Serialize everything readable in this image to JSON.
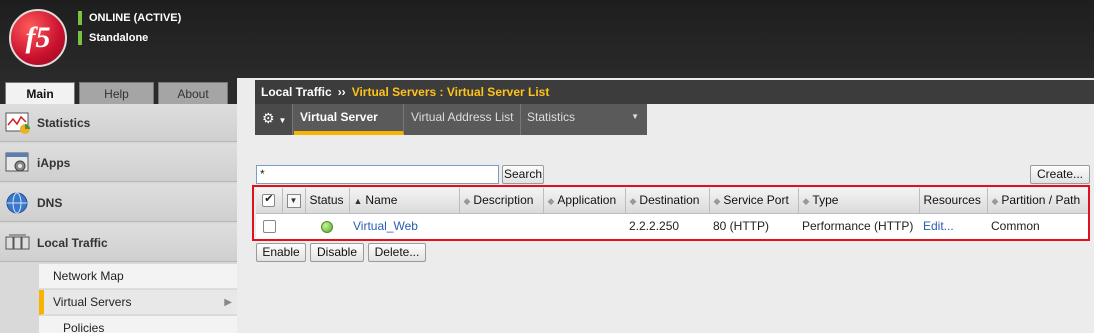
{
  "header": {
    "logo_text": "f5",
    "status_lines": [
      "ONLINE (ACTIVE)",
      "Standalone"
    ],
    "status_color": "#7bc142"
  },
  "leftnav": {
    "tabs": [
      {
        "label": "Main",
        "active": true
      },
      {
        "label": "Help",
        "active": false
      },
      {
        "label": "About",
        "active": false
      }
    ],
    "sections": [
      {
        "label": "Statistics",
        "icon": "statistics-chart-icon"
      },
      {
        "label": "iApps",
        "icon": "iapps-gear-icon"
      },
      {
        "label": "DNS",
        "icon": "dns-globe-icon"
      },
      {
        "label": "Local Traffic",
        "icon": "local-traffic-icon"
      }
    ],
    "subitems": [
      {
        "label": "Network Map",
        "active": false
      },
      {
        "label": "Virtual Servers",
        "active": true
      },
      {
        "label": "Policies",
        "active": false
      }
    ]
  },
  "breadcrumb": {
    "root": "Local Traffic",
    "separator": "››",
    "current": "Virtual Servers : Virtual Server List"
  },
  "subtabs": [
    {
      "label": "Virtual Server List",
      "active": true
    },
    {
      "label": "Virtual Address List",
      "active": false
    },
    {
      "label": "Statistics",
      "active": false
    }
  ],
  "search": {
    "value": "*",
    "button": "Search"
  },
  "create_button": "Create...",
  "table": {
    "columns": [
      "Status",
      "Name",
      "Description",
      "Application",
      "Destination",
      "Service Port",
      "Type",
      "Resources",
      "Partition / Path"
    ],
    "rows": [
      {
        "name": "Virtual_Web",
        "description": "",
        "application": "",
        "destination": "2.2.2.250",
        "service_port": "80 (HTTP)",
        "type": "Performance (HTTP)",
        "resources": "Edit...",
        "partition": "Common"
      }
    ]
  },
  "actions": [
    "Enable",
    "Disable",
    "Delete..."
  ],
  "colors": {
    "accent": "#f6b300",
    "link": "#2a5db0",
    "highlight": "#e0101c"
  }
}
